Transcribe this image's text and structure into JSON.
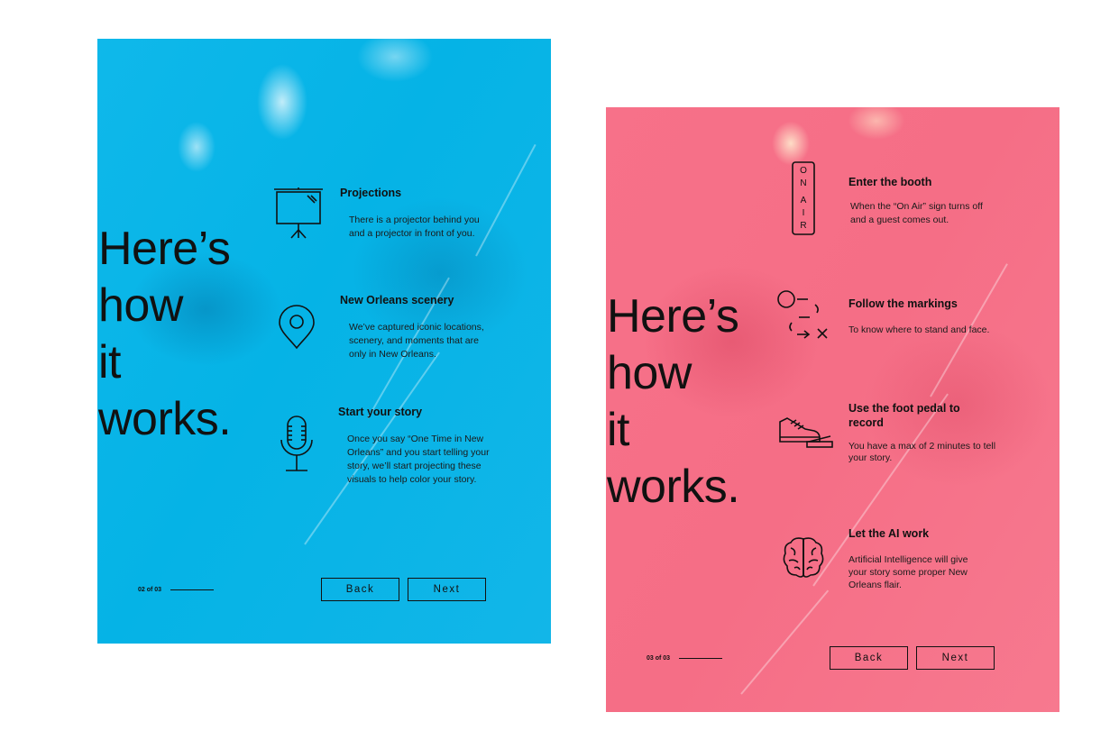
{
  "screens": [
    {
      "headline": [
        "Here’s",
        "how",
        "it",
        "works."
      ],
      "features": [
        {
          "icon": "projector-screen-icon",
          "title": "Projections",
          "description": "There is a projector behind you\nand a projector in front of you."
        },
        {
          "icon": "map-pin-icon",
          "title": "New Orleans scenery",
          "description": "We’ve captured iconic locations,\nscenery, and moments that are\nonly in New Orleans."
        },
        {
          "icon": "microphone-icon",
          "title": "Start your story",
          "description": "Once you say “One Time in New\nOrleans” and you start telling your\nstory, we’ll start projecting these\nvisuals to help color your story."
        }
      ],
      "pager": "02 of 03",
      "back_label": "Back",
      "next_label": "Next",
      "background": "#05b3e6"
    },
    {
      "headline": [
        "Here’s",
        "how",
        "it",
        "works."
      ],
      "features": [
        {
          "icon": "on-air-sign-icon",
          "icon_text": [
            "O",
            "N",
            "A",
            "I",
            "R"
          ],
          "title": "Enter the booth",
          "description": "When the “On Air” sign turns off\nand a guest comes out."
        },
        {
          "icon": "floor-markings-icon",
          "title": "Follow the markings",
          "description": "To know where to stand and face."
        },
        {
          "icon": "sneaker-foot-pedal-icon",
          "title": "Use the foot pedal to\nrecord",
          "description": "You have a max of 2 minutes to tell\nyour story."
        },
        {
          "icon": "brain-icon",
          "title": "Let the AI work",
          "description": "Artificial Intelligence will give\nyour story some proper New\nOrleans flair."
        }
      ],
      "pager": "03 of 03",
      "back_label": "Back",
      "next_label": "Next",
      "background": "#f56e86"
    }
  ]
}
